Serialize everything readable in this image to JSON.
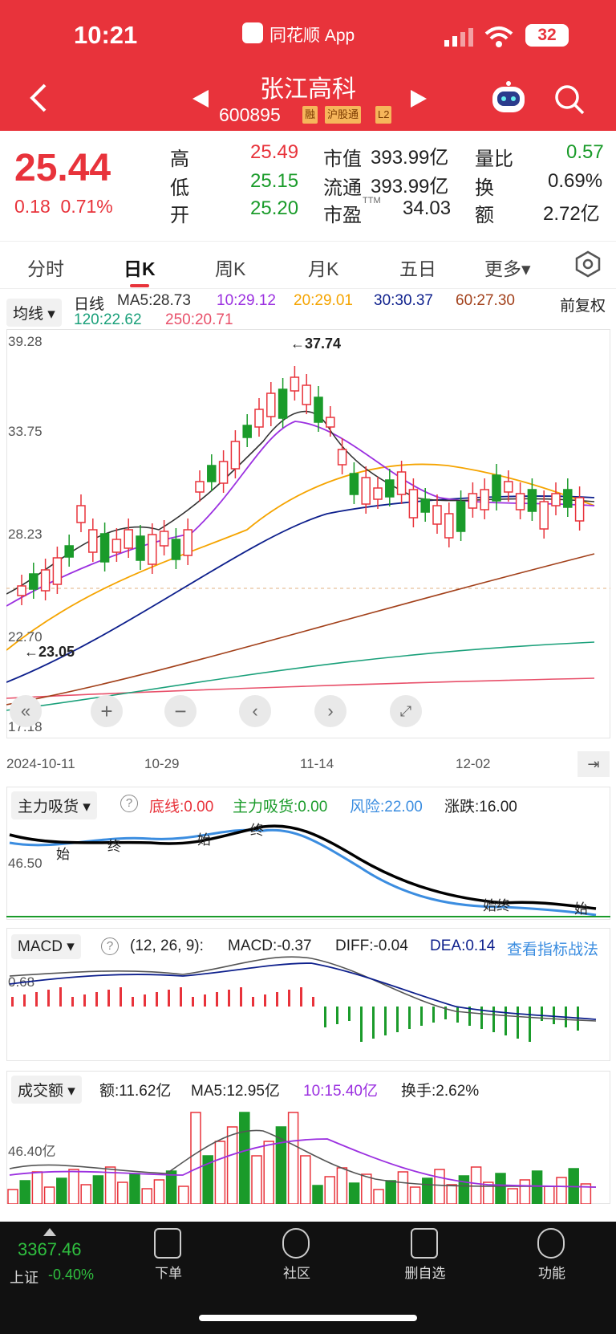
{
  "status": {
    "time": "10:21",
    "app": "同花顺 App",
    "battery": "32"
  },
  "stock": {
    "name": "张江高科",
    "code": "600895",
    "tags": [
      "融",
      "沪股通",
      "L2"
    ]
  },
  "quote": {
    "price": "25.44",
    "change": "0.18",
    "pct": "0.71%",
    "high_label": "高",
    "high": "25.49",
    "low_label": "低",
    "low": "25.15",
    "open_label": "开",
    "open": "25.20",
    "mcap_label": "市值",
    "mcap": "393.99亿",
    "float_label": "流通",
    "float": "393.99亿",
    "pe_label": "市盈",
    "pe_sup": "TTM",
    "pe": "34.03",
    "vr_label": "量比",
    "vr": "0.57",
    "turn_label": "换",
    "turn": "0.69%",
    "amt_label": "额",
    "amt": "2.72亿"
  },
  "tabs": [
    "分时",
    "日K",
    "周K",
    "月K",
    "五日",
    "更多▾"
  ],
  "active_tab": "日K",
  "kline": {
    "selector": "均线 ▾",
    "daily": "日线",
    "ma5": "MA5:28.73",
    "ma10": "10:29.12",
    "ma20": "20:29.01",
    "ma30": "30:30.37",
    "ma60": "60:27.30",
    "ma120": "120:22.62",
    "ma250": "250:20.71",
    "adjust": "前复权",
    "y_labels": [
      "39.28",
      "33.75",
      "28.23",
      "22.70",
      "17.18"
    ],
    "high_mark": "←37.74",
    "low_mark": "←23.05",
    "dates": [
      "2024-10-11",
      "10-29",
      "11-14",
      "12-02"
    ]
  },
  "ind1": {
    "name": "主力吸货 ▾",
    "help": "?",
    "bottom": "底线:0.00",
    "absorb": "主力吸货:0.00",
    "risk": "风险:22.00",
    "change": "涨跌:16.00",
    "y_label": "46.50",
    "marks": [
      "始",
      "终",
      "始",
      "终",
      "始终",
      "始"
    ]
  },
  "macd": {
    "name": "MACD ▾",
    "help": "?",
    "params": "(12, 26, 9):",
    "macd": "MACD:-0.37",
    "diff": "DIFF:-0.04",
    "dea": "DEA:0.14",
    "link": "查看指标战法",
    "y_label": "0.68"
  },
  "volume": {
    "name": "成交额 ▾",
    "amt": "额:11.62亿",
    "ma5": "MA5:12.95亿",
    "ma10": "10:15.40亿",
    "turn": "换手:2.62%",
    "y_label": "46.40亿"
  },
  "bottom_nav": {
    "index_value": "3367.46",
    "index_name": "上证",
    "index_chg": "-0.40%",
    "items": [
      "下单",
      "社区",
      "删自选",
      "功能"
    ]
  },
  "colors": {
    "red": "#e8333b",
    "green": "#1a9b2a",
    "ma5": "#333333",
    "ma10": "#9b30e0",
    "ma20": "#f5a400",
    "ma30": "#0d1f8c",
    "ma60": "#a2401a",
    "ma120": "#1aa07a",
    "ma250": "#e8506a"
  }
}
